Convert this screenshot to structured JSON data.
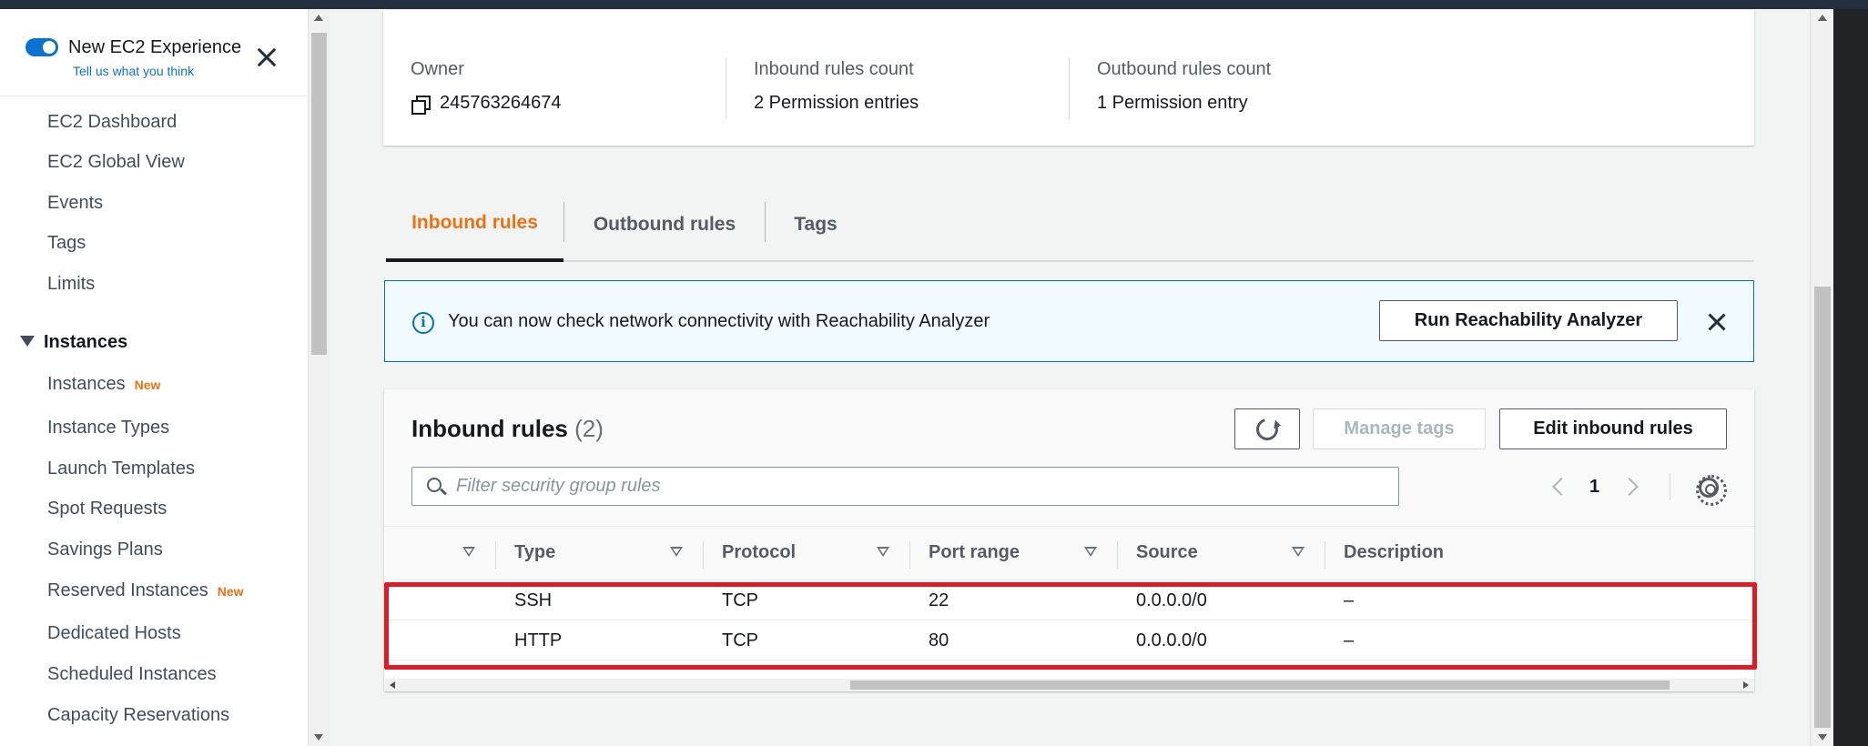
{
  "sidebar": {
    "experience_toggle": {
      "title": "New EC2 Experience",
      "link": "Tell us what you think",
      "enabled": true
    },
    "items": [
      {
        "label": "EC2 Dashboard"
      },
      {
        "label": "EC2 Global View"
      },
      {
        "label": "Events"
      },
      {
        "label": "Tags"
      },
      {
        "label": "Limits"
      }
    ],
    "section": {
      "label": "Instances",
      "expanded": true
    },
    "section_items": [
      {
        "label": "Instances",
        "badge": "New"
      },
      {
        "label": "Instance Types"
      },
      {
        "label": "Launch Templates"
      },
      {
        "label": "Spot Requests"
      },
      {
        "label": "Savings Plans"
      },
      {
        "label": "Reserved Instances",
        "badge": "New"
      },
      {
        "label": "Dedicated Hosts"
      },
      {
        "label": "Scheduled Instances"
      },
      {
        "label": "Capacity Reservations"
      }
    ]
  },
  "details": {
    "owner": {
      "label": "Owner",
      "value": "245763264674"
    },
    "inbound_count": {
      "label": "Inbound rules count",
      "value": "2 Permission entries"
    },
    "outbound_count": {
      "label": "Outbound rules count",
      "value": "1 Permission entry"
    }
  },
  "tabs": [
    {
      "label": "Inbound rules",
      "active": true
    },
    {
      "label": "Outbound rules",
      "active": false
    },
    {
      "label": "Tags",
      "active": false
    }
  ],
  "flash": {
    "message": "You can now check network connectivity with Reachability Analyzer",
    "button": "Run Reachability Analyzer"
  },
  "rules": {
    "title": "Inbound rules",
    "count": "(2)",
    "manage_tags_label": "Manage tags",
    "edit_label": "Edit inbound rules",
    "search_placeholder": "Filter security group rules",
    "page": "1",
    "columns": [
      "Type",
      "Protocol",
      "Port range",
      "Source",
      "Description"
    ],
    "rows": [
      {
        "type": "SSH",
        "protocol": "TCP",
        "port_range": "22",
        "source": "0.0.0.0/0",
        "description": "–"
      },
      {
        "type": "HTTP",
        "protocol": "TCP",
        "port_range": "80",
        "source": "0.0.0.0/0",
        "description": "–"
      }
    ]
  },
  "colors": {
    "accent_orange": "#ec7211",
    "link_blue": "#0972d3",
    "info_blue": "#0073bb",
    "highlight_red": "#e01b24"
  }
}
